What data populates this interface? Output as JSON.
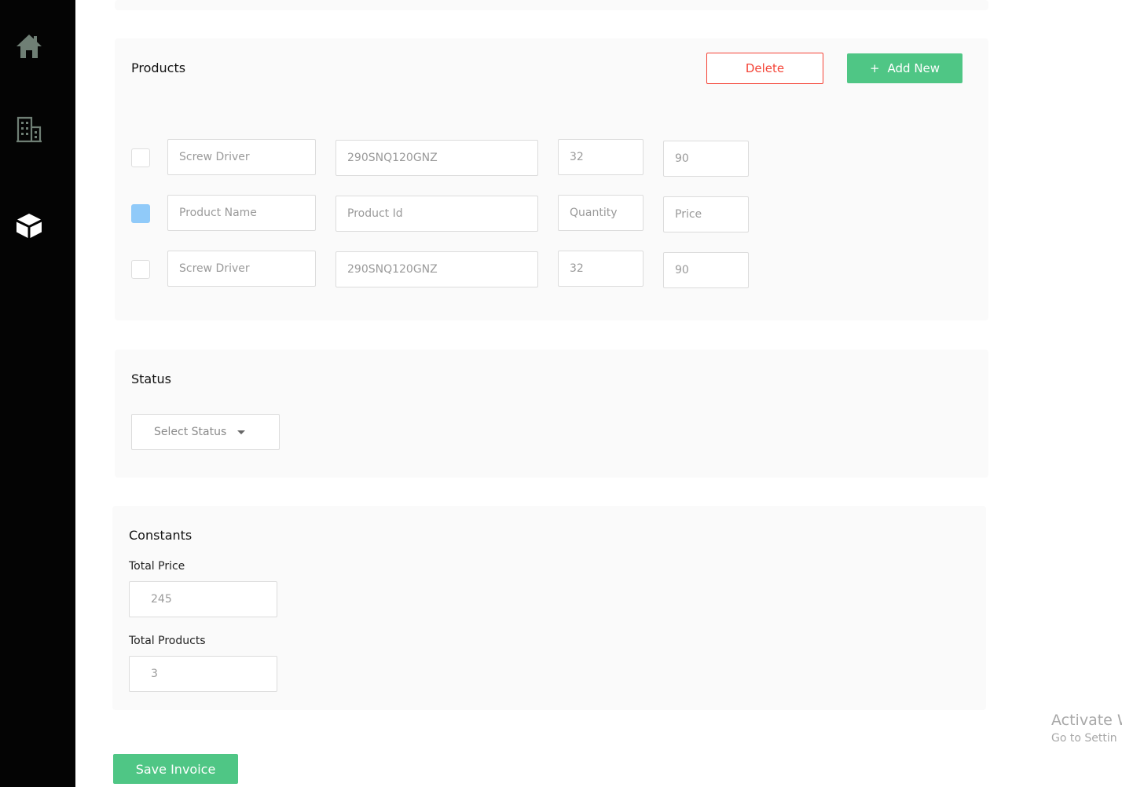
{
  "sidebar": {
    "items": [
      {
        "icon": "home-icon"
      },
      {
        "icon": "building-icon"
      },
      {
        "icon": "cube-icon"
      }
    ]
  },
  "products": {
    "title": "Products",
    "delete_label": "Delete",
    "add_icon": "+",
    "add_label": "Add New",
    "rows": [
      {
        "checked": false,
        "name": "Screw Driver",
        "id": "290SNQ120GNZ",
        "quantity": "32",
        "price": "90"
      },
      {
        "checked": true,
        "name": "Product Name",
        "id": "Product Id",
        "quantity": "Quantity",
        "price": "Price"
      },
      {
        "checked": false,
        "name": "Screw Driver",
        "id": "290SNQ120GNZ",
        "quantity": "32",
        "price": "90"
      }
    ]
  },
  "status": {
    "title": "Status",
    "select_value": "Select Status"
  },
  "constants": {
    "title": "Constants",
    "total_price_label": "Total Price",
    "total_price_value": "245",
    "total_products_label": "Total Products",
    "total_products_value": "3"
  },
  "save_label": "Save Invoice",
  "watermark": {
    "line1": "Activate W",
    "line2": "Go to Settin"
  },
  "colors": {
    "sidebar": "#040404",
    "accent_green": "#4fc685",
    "danger_red": "#f44336",
    "checkbox_checked": "#90caf9"
  }
}
